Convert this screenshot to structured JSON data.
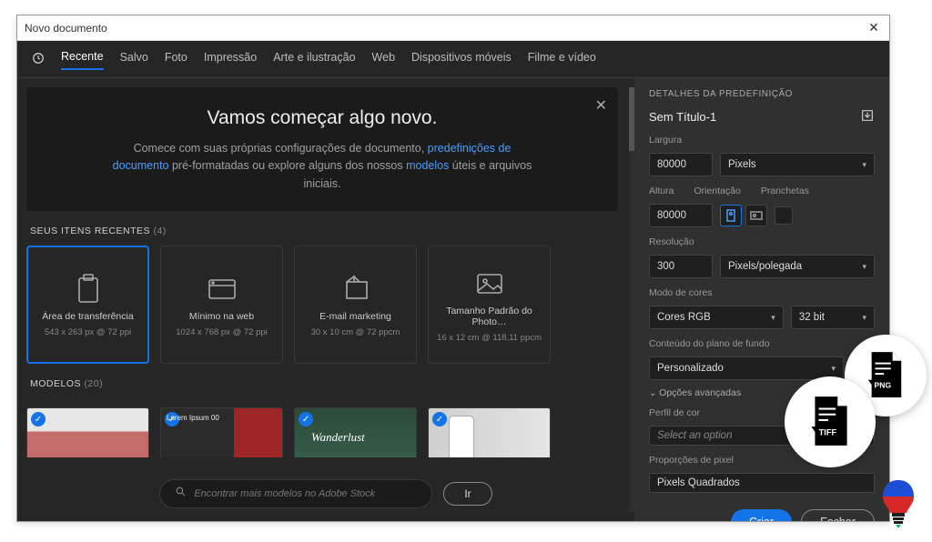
{
  "window": {
    "title": "Novo documento"
  },
  "tabs": [
    "Recente",
    "Salvo",
    "Foto",
    "Impressão",
    "Arte e ilustração",
    "Web",
    "Dispositivos móveis",
    "Filme e vídeo"
  ],
  "active_tab": 0,
  "hero": {
    "title": "Vamos começar algo novo.",
    "p1": "Comece com suas próprias configurações de documento, ",
    "link1": "predefinições de documento",
    "p2": " pré-formatadas ou explore alguns dos nossos ",
    "link2": "modelos",
    "p3": " úteis e arquivos iniciais."
  },
  "recent": {
    "label": "SEUS ITENS RECENTES",
    "count": "(4)",
    "items": [
      {
        "name": "Área de transferência",
        "sub": "543 x 263 px @ 72 ppi",
        "icon": "clipboard"
      },
      {
        "name": "Mínimo na web",
        "sub": "1024 x 768 px @ 72 ppi",
        "icon": "browser"
      },
      {
        "name": "E-mail marketing",
        "sub": "30 x 10 cm @ 72 ppcm",
        "icon": "fold"
      },
      {
        "name": "Tamanho Padrão do Photo…",
        "sub": "16 x 12 cm @ 118,11 ppcm",
        "icon": "image"
      }
    ]
  },
  "templates": {
    "label": "MODELOS",
    "count": "(20)"
  },
  "search": {
    "placeholder": "Encontrar mais modelos no Adobe Stock",
    "go": "Ir"
  },
  "panel": {
    "header": "DETALHES DA PREDEFINIÇÃO",
    "doc_name": "Sem Título-1",
    "width_label": "Largura",
    "width_value": "80000",
    "units": "Pixels",
    "height_label": "Altura",
    "height_value": "80000",
    "orient_label": "Orientação",
    "artboards_label": "Pranchetas",
    "res_label": "Resolução",
    "res_value": "300",
    "res_units": "Pixels/polegada",
    "color_label": "Modo de cores",
    "color_mode": "Cores RGB",
    "bit_depth": "32 bit",
    "bg_label": "Conteúdo do plano de fundo",
    "bg_value": "Personalizado",
    "advanced": "Opções avançadas",
    "profile_label": "Perfil de cor",
    "profile_value": "Select an option",
    "pixel_ratio_label": "Proporções de pixel",
    "pixel_ratio_value": "Pixels Quadrados",
    "create": "Criar",
    "close": "Fechar"
  },
  "badges": {
    "png": "PNG",
    "tiff": "TIFF"
  }
}
